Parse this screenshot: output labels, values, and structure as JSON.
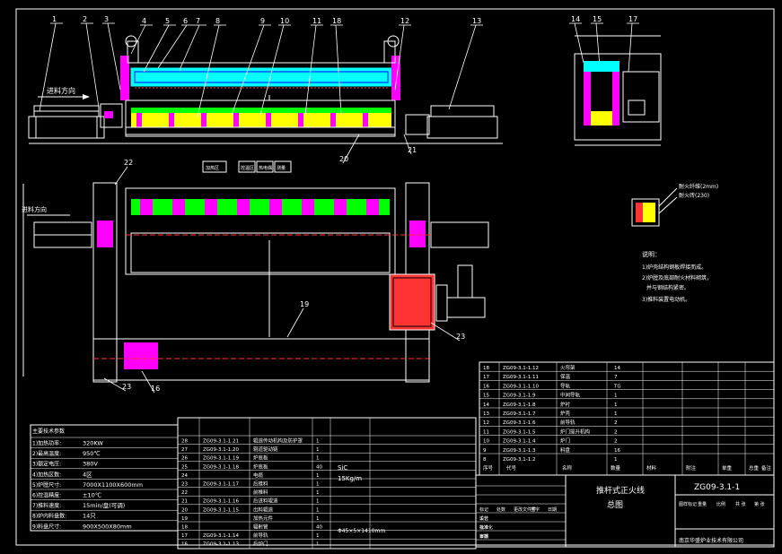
{
  "colors": {
    "background": "#000000",
    "line": "#ffffff",
    "centerline": "#ff3333",
    "furnace_top": "#00ffff",
    "heater": "#ff00ff",
    "yellow": "#ffff00",
    "green": "#00ff00",
    "blue": "#0000ff",
    "olive": "#a0a000"
  },
  "callouts_top": [
    "1",
    "2",
    "3",
    "4",
    "5",
    "6",
    "7",
    "8",
    "9",
    "10",
    "11",
    "18",
    "12",
    "13",
    "14",
    "15",
    "17"
  ],
  "callouts_other": [
    "20",
    "21",
    "22",
    "19",
    "23",
    "23",
    "16"
  ],
  "labels": {
    "feed_dir_top": "进料方向",
    "feed_dir_plan": "进料方向",
    "model_front": "ZG09-3.1-1",
    "drawing_title_1": "推杆式正火线",
    "drawing_title_2": "总图",
    "company": "南京华盛炉业技术有限公司",
    "sic": "SiC",
    "sic_rate": "15Kg/m",
    "pipe_spec": "Φ45×5×1410mm",
    "detail_a": "耐火纤维(2mm)",
    "detail_b": "耐火砖(230)"
  },
  "notes": {
    "title": "说明：",
    "lines": [
      "1)炉壳结构钢板焊接而成。",
      "2)炉膛及底部耐火材料砌筑，",
      "并与钢结构紧密。",
      "3)推料装置电动机。"
    ]
  },
  "specs": {
    "title": "主要技术参数",
    "rows": [
      {
        "k": "1)加热功率:",
        "v": "320KW"
      },
      {
        "k": "2)最高温度:",
        "v": "950℃"
      },
      {
        "k": "3)额定电压:",
        "v": "380V"
      },
      {
        "k": "4)加热区数:",
        "v": "4区"
      },
      {
        "k": "5)炉膛尺寸:",
        "v": "7000X1100X600mm"
      },
      {
        "k": "6)控温精度:",
        "v": "±10℃"
      },
      {
        "k": "7)推料速度:",
        "v": "15min/盘(可调)"
      },
      {
        "k": "8)炉内料盘数:",
        "v": "14只"
      },
      {
        "k": "9)料盘尺寸:",
        "v": "900X500X80mm"
      }
    ]
  },
  "bom_right": {
    "rows": [
      {
        "no": "18",
        "code": "ZG09-3.1-1.12",
        "name": "火帘架",
        "qty": "14"
      },
      {
        "no": "17",
        "code": "ZG09-3.1-1.11",
        "name": "保温",
        "qty": "7"
      },
      {
        "no": "16",
        "code": "ZG09-3.1-1.10",
        "name": "导轨",
        "qty": "TG"
      },
      {
        "no": "15",
        "code": "ZG09-3.1-1.9",
        "name": "中间导轨",
        "qty": "1"
      },
      {
        "no": "14",
        "code": "ZG09-3.1-1.8",
        "name": "炉衬",
        "qty": "1"
      },
      {
        "no": "13",
        "code": "ZG09-3.1-1.7",
        "name": "炉壳",
        "qty": "1"
      },
      {
        "no": "12",
        "code": "ZG09-3.1-1.6",
        "name": "前导轨",
        "qty": "2"
      },
      {
        "no": "11",
        "code": "ZG09-3.1-1.5",
        "name": "炉门提升机构",
        "qty": "2"
      },
      {
        "no": "10",
        "code": "ZG09-3.1-1.4",
        "name": "炉门",
        "qty": "2"
      },
      {
        "no": "9",
        "code": "ZG09-3.1-1.3",
        "name": "料盘",
        "qty": "16"
      },
      {
        "no": "8",
        "code": "ZG09-3.1-1.2",
        "name": "",
        "qty": "1"
      }
    ],
    "header": [
      "序号",
      "代号",
      "名称",
      "数量",
      "材料",
      "附注",
      "单重",
      "总重",
      "备注"
    ]
  },
  "bom_left": {
    "rows": [
      {
        "no": "28",
        "code": "ZG09-3.1-1.21",
        "name": "辊道传动机构及防护罩",
        "qty": "1"
      },
      {
        "no": "27",
        "code": "ZG09-3.1-1.20",
        "name": "辊道驱动链",
        "qty": "1"
      },
      {
        "no": "26",
        "code": "ZG09-3.1-1.19",
        "name": "炉底板",
        "qty": "1"
      },
      {
        "no": "25",
        "code": "ZG09-3.1-1.18",
        "name": "炉底板",
        "qty": "40",
        "mat": "SiC",
        "rate": "15Kg/m"
      },
      {
        "no": "24",
        "code": "",
        "name": "电缆",
        "qty": "1"
      },
      {
        "no": "23",
        "code": "ZG09-3.1-1.17",
        "name": "后推料",
        "qty": "1"
      },
      {
        "no": "22",
        "code": "",
        "name": "前推料",
        "qty": "1"
      },
      {
        "no": "21",
        "code": "ZG09-3.1-1.16",
        "name": "后进料辊道",
        "qty": "1"
      },
      {
        "no": "20",
        "code": "ZG09-3.1-1.15",
        "name": "出料辊道",
        "qty": "1"
      },
      {
        "no": "19",
        "code": "",
        "name": "加热元件",
        "qty": "1"
      },
      {
        "no": "18",
        "code": "",
        "name": "辐射管",
        "qty": "40",
        "mat": "Φ45×5×1410mm"
      },
      {
        "no": "17",
        "code": "ZG09-3.1-1.14",
        "name": "前导轨",
        "qty": "1"
      },
      {
        "no": "16",
        "code": "ZG09-3.1-1.13",
        "name": "后炉门",
        "qty": "1"
      }
    ]
  },
  "title_block": {
    "left_cells": [
      "标记",
      "处数",
      "更改文件号",
      "签字",
      "日期"
    ],
    "role_cells": [
      "设计",
      "标准化",
      "审核",
      "工艺",
      "批准",
      "日期"
    ],
    "right_cells": [
      "图样标记",
      "重量",
      "比例",
      "共 张",
      "第 张"
    ]
  },
  "legend_boxes": [
    "加热区",
    "控温区",
    "热电偶",
    "测量"
  ]
}
